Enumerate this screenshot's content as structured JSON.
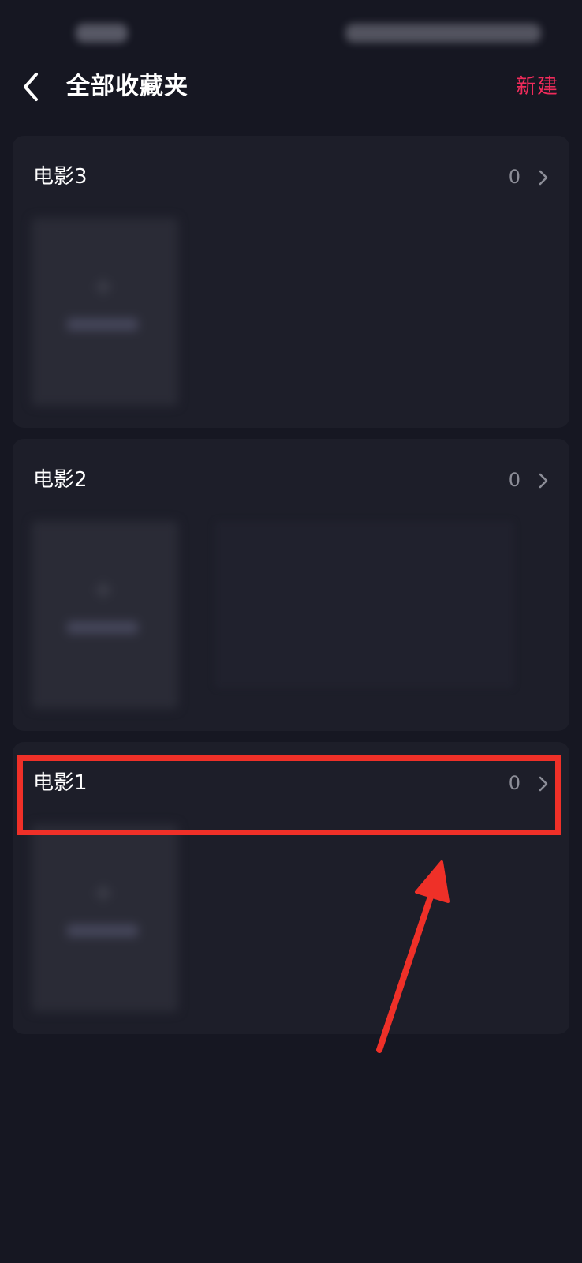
{
  "header": {
    "title": "全部收藏夹",
    "new_label": "新建"
  },
  "folders": [
    {
      "name": "电影3",
      "count": "0"
    },
    {
      "name": "电影2",
      "count": "0"
    },
    {
      "name": "电影1",
      "count": "0"
    }
  ],
  "colors": {
    "background": "#161722",
    "card": "#1d1e29",
    "accent": "#f02b5b",
    "annotation": "#ef3028"
  },
  "icons": {
    "back": "chevron-left-icon",
    "folder_open": "chevron-right-icon"
  }
}
